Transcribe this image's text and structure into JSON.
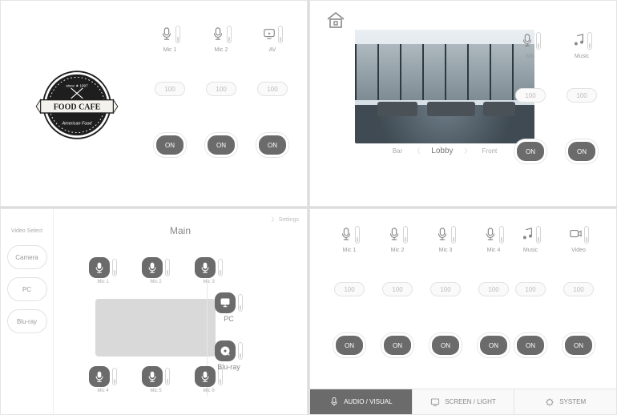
{
  "p1": {
    "logo": {
      "top": "since 1997",
      "main": "FOOD CAFE",
      "sub": "American Food"
    },
    "cols": [
      {
        "icon": "mic",
        "label": "Mic 1",
        "value": "100",
        "on": "ON"
      },
      {
        "icon": "mic",
        "label": "Mic 2",
        "value": "100",
        "on": "ON"
      },
      {
        "icon": "av",
        "label": "AV",
        "value": "100",
        "on": "ON"
      }
    ]
  },
  "p2": {
    "nav": {
      "left": "Bar",
      "center": "Lobby",
      "right": "Front"
    },
    "cols": [
      {
        "icon": "mic",
        "label": "Mic",
        "value": "100",
        "on": "ON"
      },
      {
        "icon": "music",
        "label": "Music",
        "value": "100",
        "on": "ON"
      }
    ]
  },
  "p3": {
    "side_header": "Video Select",
    "side": [
      "Camera",
      "PC",
      "Blu-ray"
    ],
    "settings": "Settings",
    "title": "Main",
    "seats": [
      "Mic 1",
      "Mic 2",
      "Mic 3",
      "Mic 4",
      "Mic 5",
      "Mic 6"
    ],
    "right": [
      {
        "icon": "pc",
        "label": "PC"
      },
      {
        "icon": "bluray",
        "label": "Blu-ray"
      }
    ]
  },
  "p4": {
    "left": [
      {
        "label": "Mic 1",
        "value": "100",
        "on": "ON"
      },
      {
        "label": "Mic 2",
        "value": "100",
        "on": "ON"
      },
      {
        "label": "Mic 3",
        "value": "100",
        "on": "ON"
      },
      {
        "label": "Mic 4",
        "value": "100",
        "on": "ON"
      }
    ],
    "right": [
      {
        "icon": "music",
        "label": "Music",
        "value": "100",
        "on": "ON"
      },
      {
        "icon": "video",
        "label": "Video",
        "value": "100",
        "on": "ON"
      }
    ],
    "tabs": [
      {
        "label": "AUDIO / VISUAL",
        "active": true
      },
      {
        "label": "SCREEN / LIGHT",
        "active": false
      },
      {
        "label": "SYSTEM",
        "active": false
      }
    ]
  }
}
